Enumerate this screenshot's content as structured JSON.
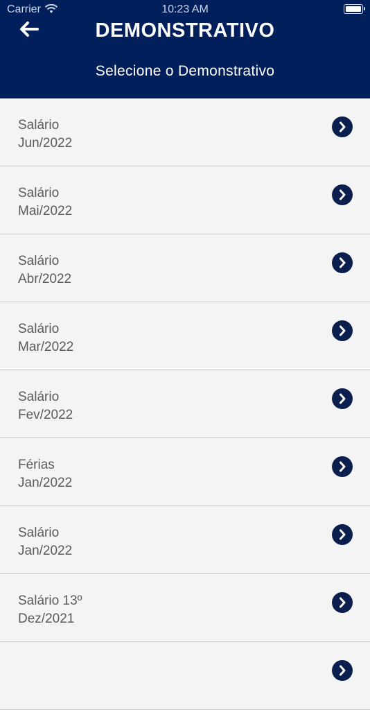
{
  "status_bar": {
    "carrier": "Carrier",
    "time": "10:23 AM"
  },
  "header": {
    "title": "DEMONSTRATIVO",
    "subtitle": "Selecione o Demonstrativo",
    "background_color": "#001f5b",
    "back_icon": "arrow-left-icon"
  },
  "items": [
    {
      "type": "Salário",
      "period": "Jun/2022"
    },
    {
      "type": "Salário",
      "period": "Mai/2022"
    },
    {
      "type": "Salário",
      "period": "Abr/2022"
    },
    {
      "type": "Salário",
      "period": "Mar/2022"
    },
    {
      "type": "Salário",
      "period": "Fev/2022"
    },
    {
      "type": "Férias",
      "period": "Jan/2022"
    },
    {
      "type": "Salário",
      "period": "Jan/2022"
    },
    {
      "type": "Salário 13º",
      "period": "Dez/2021"
    },
    {
      "type": "",
      "period": ""
    }
  ],
  "chevron_icon": "chevron-right-circle-icon",
  "chevron_color": "#0b1f4f"
}
